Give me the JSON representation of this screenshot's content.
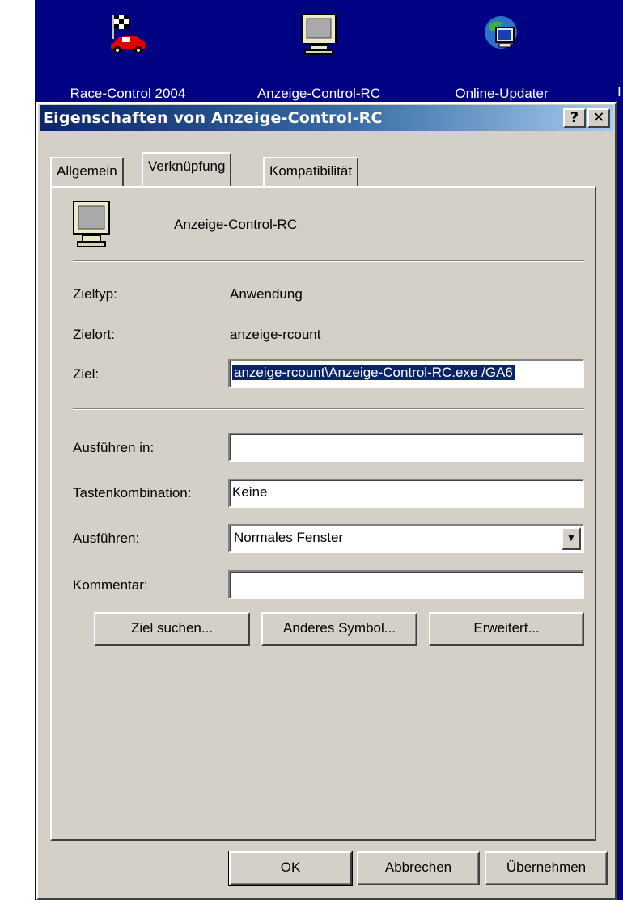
{
  "desktop": {
    "icons": [
      {
        "name": "race-control-icon",
        "label": "Race-Control 2004"
      },
      {
        "name": "monitor-icon",
        "label": "Anzeige-Control-RC"
      },
      {
        "name": "globe-icon",
        "label": "Online-Updater"
      }
    ],
    "edge_text": "I"
  },
  "window": {
    "title": "Eigenschaften von Anzeige-Control-RC",
    "help_label": "?",
    "close_label": "✕"
  },
  "tabs": [
    {
      "label": "Allgemein",
      "active": false
    },
    {
      "label": "Verknüpfung",
      "active": true
    },
    {
      "label": "Kompatibilität",
      "active": false
    }
  ],
  "shortcut": {
    "name": "Anzeige-Control-RC",
    "target_type_label": "Zieltyp:",
    "target_type_value": "Anwendung",
    "target_location_label": "Zielort:",
    "target_location_value": "anzeige-rcount",
    "target_label": "Ziel:",
    "target_value": "anzeige-rcount\\Anzeige-Control-RC.exe /GA6",
    "start_in_label": "Ausführen in:",
    "start_in_value": "",
    "hotkey_label": "Tastenkombination:",
    "hotkey_value": "Keine",
    "run_label": "Ausführen:",
    "run_value": "Normales Fenster",
    "comment_label": "Kommentar:",
    "comment_value": ""
  },
  "buttons": {
    "find_target": "Ziel suchen...",
    "change_icon": "Anderes Symbol...",
    "advanced": "Erweitert...",
    "ok": "OK",
    "cancel": "Abbrechen",
    "apply": "Übernehmen"
  },
  "colors": {
    "desktop": "#010183",
    "titlebar_start": "#0a246a",
    "titlebar_end": "#a6caf0",
    "dialog": "#d4d0c8"
  }
}
